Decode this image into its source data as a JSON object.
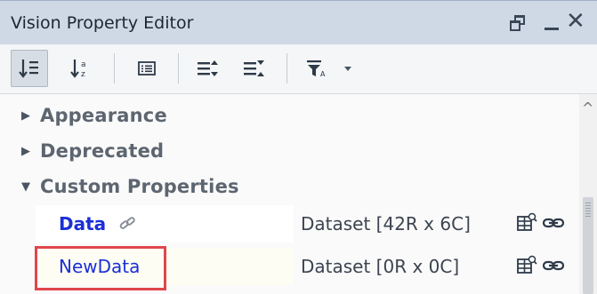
{
  "window": {
    "title": "Vision Property Editor"
  },
  "toolbar": {
    "buttons": [
      {
        "icon": "sort-categorized-icon"
      },
      {
        "icon": "sort-alphabetical-icon"
      },
      {
        "icon": "details-icon"
      },
      {
        "icon": "expand-all-icon"
      },
      {
        "icon": "collapse-all-icon"
      },
      {
        "icon": "filter-icon"
      },
      {
        "icon": "dropdown-arrow-icon"
      }
    ]
  },
  "categories": [
    {
      "label": "Appearance",
      "expanded": false
    },
    {
      "label": "Deprecated",
      "expanded": false
    },
    {
      "label": "Custom Properties",
      "expanded": true
    }
  ],
  "properties": [
    {
      "name": "Data",
      "value": "Dataset [42R x 6C]",
      "bound": true
    },
    {
      "name": "NewData",
      "value": "Dataset [0R x 0C]",
      "bound": false
    }
  ],
  "colors": {
    "titlebar": "#cfd9e6",
    "property_name": "#1b2fd6",
    "highlight": "#e0464b"
  }
}
